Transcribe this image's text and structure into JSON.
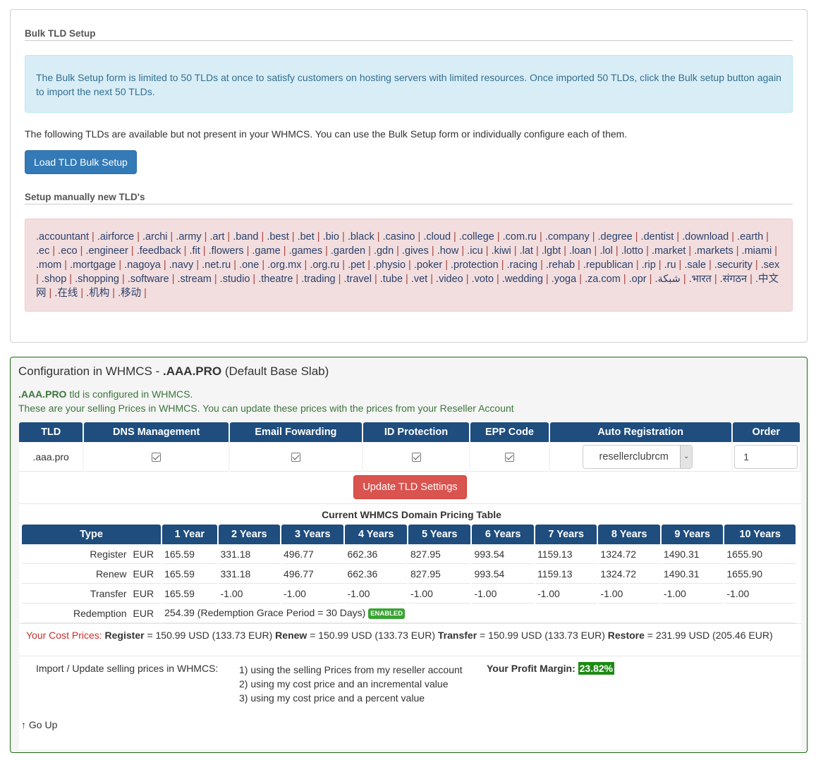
{
  "bulk": {
    "title": "Bulk TLD Setup",
    "info_text": "The Bulk Setup form is limited to 50 TLDs at once to satisfy customers on hosting servers with limited resources. Once imported 50 TLDs, click the Bulk setup button again to import the next 50 TLDs.",
    "available_text": "The following TLDs are available but not present in your WHMCS. You can use the Bulk Setup form or individually configure each of them.",
    "load_button": "Load TLD Bulk Setup",
    "manual_title": "Setup manually new TLD's",
    "tlds": [
      ".accountant",
      ".airforce",
      ".archi",
      ".army",
      ".art",
      ".band",
      ".best",
      ".bet",
      ".bio",
      ".black",
      ".casino",
      ".cloud",
      ".college",
      ".com.ru",
      ".company",
      ".degree",
      ".dentist",
      ".download",
      ".earth",
      ".ec",
      ".eco",
      ".engineer",
      ".feedback",
      ".fit",
      ".flowers",
      ".game",
      ".games",
      ".garden",
      ".gdn",
      ".gives",
      ".how",
      ".icu",
      ".kiwi",
      ".lat",
      ".lgbt",
      ".loan",
      ".lol",
      ".lotto",
      ".market",
      ".markets",
      ".miami",
      ".mom",
      ".mortgage",
      ".nagoya",
      ".navy",
      ".net.ru",
      ".one",
      ".org.mx",
      ".org.ru",
      ".pet",
      ".physio",
      ".poker",
      ".protection",
      ".racing",
      ".rehab",
      ".republican",
      ".rip",
      ".ru",
      ".sale",
      ".security",
      ".sex",
      ".shop",
      ".shopping",
      ".software",
      ".stream",
      ".studio",
      ".theatre",
      ".trading",
      ".travel",
      ".tube",
      ".vet",
      ".video",
      ".voto",
      ".wedding",
      ".yoga",
      ".za.com",
      ".opr",
      ".شبكة",
      ".भारत",
      ".संगठन",
      ".中文网",
      ".在线",
      ".机构",
      ".移动"
    ]
  },
  "config": {
    "title_prefix": "Configuration in WHMCS - ",
    "title_tld": ".AAA.PRO",
    "title_suffix": " (Default Base Slab)",
    "note_tld": ".AAA.PRO",
    "note_line1": " tld is configured in WHMCS.",
    "note_line2": "These are your selling Prices in WHMCS. You can update these prices with the prices from your Reseller Account",
    "tld_table": {
      "headers": [
        "TLD",
        "DNS Management",
        "Email Fowarding",
        "ID Protection",
        "EPP Code",
        "Auto Registration",
        "Order"
      ],
      "tld": ".aaa.pro",
      "dns_management": true,
      "email_forwarding": true,
      "id_protection": true,
      "epp_code": true,
      "auto_registration": "resellerclubrcm",
      "order": "1"
    },
    "update_button": "Update TLD Settings",
    "pricing": {
      "title": "Current WHMCS Domain Pricing Table",
      "headers": [
        "Type",
        "1 Year",
        "2 Years",
        "3 Years",
        "4 Years",
        "5 Years",
        "6 Years",
        "7 Years",
        "8 Years",
        "9 Years",
        "10 Years"
      ],
      "rows": [
        {
          "type": "Register",
          "currency": "EUR",
          "values": [
            "165.59",
            "331.18",
            "496.77",
            "662.36",
            "827.95",
            "993.54",
            "1159.13",
            "1324.72",
            "1490.31",
            "1655.90"
          ]
        },
        {
          "type": "Renew",
          "currency": "EUR",
          "values": [
            "165.59",
            "331.18",
            "496.77",
            "662.36",
            "827.95",
            "993.54",
            "1159.13",
            "1324.72",
            "1490.31",
            "1655.90"
          ]
        },
        {
          "type": "Transfer",
          "currency": "EUR",
          "values": [
            "165.59",
            "-1.00",
            "-1.00",
            "-1.00",
            "-1.00",
            "-1.00",
            "-1.00",
            "-1.00",
            "-1.00",
            "-1.00"
          ]
        }
      ],
      "redemption": {
        "type": "Redemption",
        "currency": "EUR",
        "text": "254.39 (Redemption Grace Period = 30 Days)",
        "badge": "ENABLED"
      }
    },
    "cost": {
      "label": "Your Cost Prices:",
      "register_label": "Register",
      "register_value": " = 150.99 USD (133.73 EUR) ",
      "renew_label": "Renew",
      "renew_value": " = 150.99 USD (133.73 EUR) ",
      "transfer_label": "Transfer",
      "transfer_value": " = 150.99 USD (133.73 EUR) ",
      "restore_label": "Restore",
      "restore_value": " = 231.99 USD (205.46 EUR)"
    },
    "import": {
      "label": "Import / Update selling prices in WHMCS:",
      "options": [
        "1) using the selling Prices from my reseller account",
        "2) using my cost price and an incremental value",
        "3) using my cost price and a percent value"
      ],
      "profit_label": "Your Profit Margin:",
      "profit_value": "23.82%"
    },
    "go_up": "↑ Go Up"
  }
}
